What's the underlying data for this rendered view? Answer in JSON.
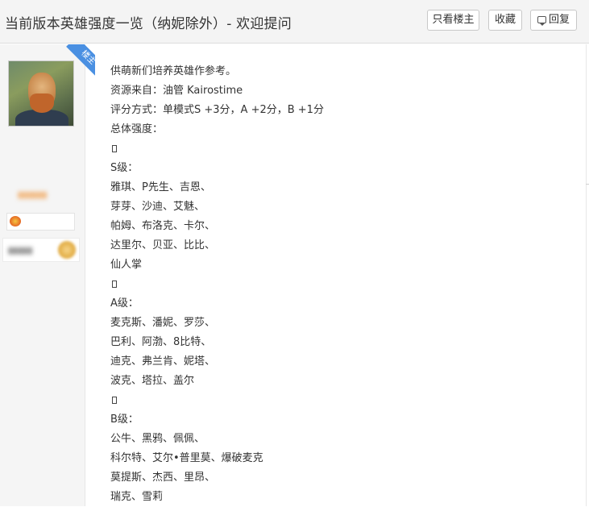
{
  "header": {
    "title": "当前版本英雄强度一览（纳妮除外）- 欢迎提问",
    "buttons": {
      "only_op": "只看楼主",
      "favorite": "收藏",
      "reply": "回复"
    }
  },
  "author": {
    "badge": "楼主"
  },
  "post": {
    "lines": [
      "供萌新们培养英雄作参考。",
      "资源来自：油管 Kairostime",
      "评分方式：单模式S +3分，A +2分，B +1分",
      "总体强度：",
      "",
      "S级：",
      "雅琪、P先生、吉恩、",
      "芽芽、沙迪、艾魅、",
      "帕姆、布洛克、卡尔、",
      "达里尔、贝亚、比比、",
      "仙人掌",
      "",
      "A级：",
      "麦克斯、潘妮、罗莎、",
      "巴利、阿渤、8比特、",
      "迪克、弗兰肯、妮塔、",
      "波克、塔拉、盖尔",
      "",
      "B级：",
      "公牛、黑鸦、佩佩、",
      "科尔特、艾尔•普里莫、爆破麦克",
      "莫提斯、杰西、里昂、",
      "瑞克、雪莉"
    ]
  }
}
